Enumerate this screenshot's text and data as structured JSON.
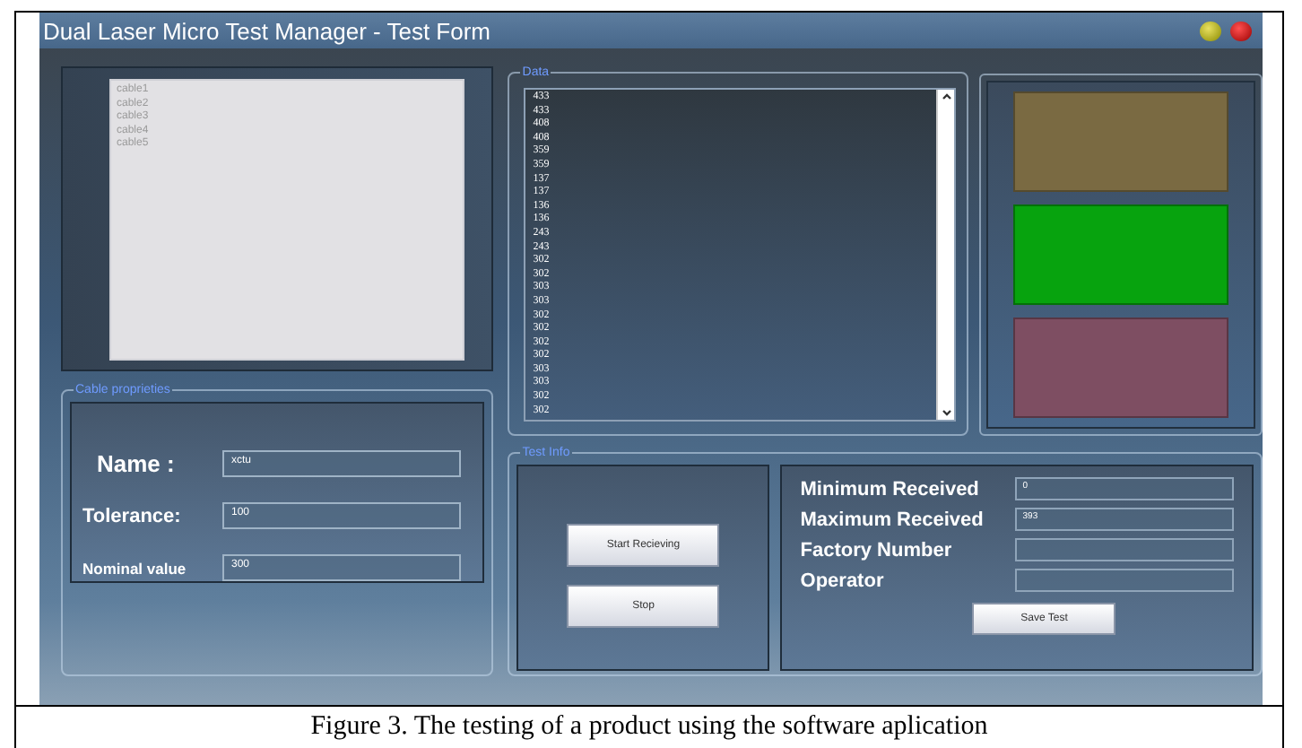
{
  "window": {
    "title": "Dual Laser Micro Test Manager - Test Form"
  },
  "cable_list": {
    "items": [
      "cable1",
      "cable2",
      "cable3",
      "cable4",
      "cable5"
    ]
  },
  "data": {
    "legend": "Data",
    "values": [
      "433",
      "433",
      "408",
      "408",
      "359",
      "359",
      "137",
      "137",
      "136",
      "136",
      "243",
      "243",
      "302",
      "302",
      "303",
      "303",
      "302",
      "302",
      "302",
      "302",
      "303",
      "303",
      "302",
      "302"
    ]
  },
  "lights": [
    {
      "color": "#7a6a42"
    },
    {
      "color": "#07a30e"
    },
    {
      "color": "#7e4e62"
    }
  ],
  "cable_properties": {
    "legend": "Cable proprieties",
    "fields": [
      {
        "label": "Name :",
        "value": "xctu"
      },
      {
        "label": "Tolerance:",
        "value": "100"
      },
      {
        "label": "Nominal value",
        "value": "300"
      }
    ]
  },
  "test_info": {
    "legend": "Test Info",
    "buttons": [
      "Start Recieving",
      "Stop"
    ],
    "fields": [
      {
        "label": "Minimum Received",
        "value": "0"
      },
      {
        "label": "Maximum Received",
        "value": "393"
      },
      {
        "label": "Factory Number"
      },
      {
        "label": "Operator"
      }
    ],
    "save_button": "Save Test"
  },
  "caption": "Figure 3. The testing of a product using the software aplication"
}
